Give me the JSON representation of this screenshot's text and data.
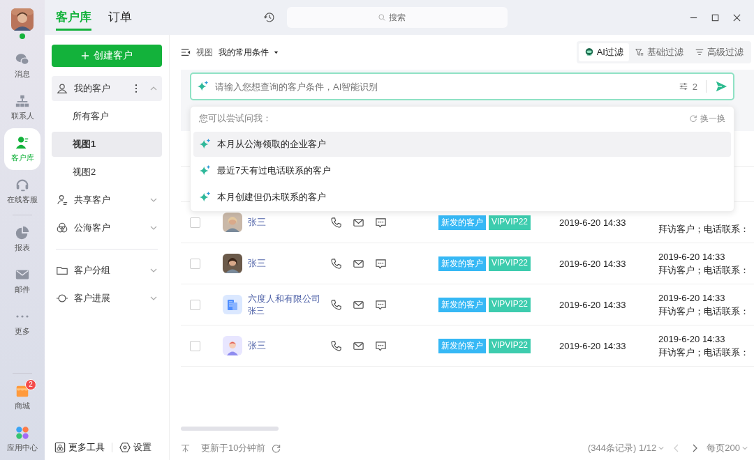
{
  "rail": {
    "items": [
      {
        "label": "消息",
        "selected": false
      },
      {
        "label": "联系人",
        "selected": false
      },
      {
        "label": "客户库",
        "selected": true
      },
      {
        "label": "在线客服",
        "selected": false
      },
      {
        "label": "报表",
        "selected": false
      },
      {
        "label": "邮件",
        "selected": false
      },
      {
        "label": "更多",
        "selected": false
      }
    ],
    "bottom": [
      {
        "label": "商城",
        "badge": "2"
      },
      {
        "label": "应用中心"
      }
    ]
  },
  "tabs": [
    {
      "label": "客户库",
      "selected": true
    },
    {
      "label": "订单",
      "selected": false
    }
  ],
  "search": {
    "placeholder": "搜索"
  },
  "nav": {
    "create_button": "创建客户",
    "sections": [
      [
        {
          "label": "我的客户",
          "expanded": true,
          "children": [
            {
              "label": "所有客户",
              "selected": false
            },
            {
              "label": "视图1",
              "selected": true
            },
            {
              "label": "视图2",
              "selected": false
            }
          ]
        },
        {
          "label": "共享客户",
          "expanded": false
        },
        {
          "label": "公海客户",
          "expanded": false
        }
      ],
      [
        {
          "label": "客户分组",
          "expanded": false
        },
        {
          "label": "客户进展",
          "expanded": false
        }
      ]
    ],
    "footer": [
      {
        "label": "更多工具"
      },
      {
        "label": "设置"
      }
    ]
  },
  "toolbar": {
    "view_label": "视图",
    "view_value": "我的常用条件",
    "filters": [
      {
        "label": "AI过滤",
        "selected": true
      },
      {
        "label": "基础过滤",
        "selected": false
      },
      {
        "label": "高级过滤",
        "selected": false
      }
    ]
  },
  "ai_input": {
    "placeholder": "请输入您想查询的客户条件，AI智能识别",
    "condition_count": "2"
  },
  "suggestions": {
    "title": "您可以尝试问我：",
    "refresh": "换一换",
    "items": [
      {
        "text": "本月从公海领取的企业客户",
        "selected": true
      },
      {
        "text": "最近7天有过电话联系的客户",
        "selected": false
      },
      {
        "text": "本月创建但仍未联系的客户",
        "selected": false
      }
    ]
  },
  "rows": [
    {
      "checked": false,
      "kind": "person",
      "name": "张三",
      "tags": [
        {
          "label": "新发的客户",
          "color": "#36b8f5"
        },
        {
          "label": "VIPVIP22",
          "color": "#3dccae"
        }
      ],
      "date": "2019-6-20 14:33",
      "last_note": "拜访客户；电话联系："
    },
    {
      "checked": false,
      "kind": "person",
      "name": "张三",
      "tags": [
        {
          "label": "新发的客户",
          "color": "#36b8f5"
        },
        {
          "label": "VIPVIP22",
          "color": "#3dccae"
        }
      ],
      "date": "2019-6-20 14:33",
      "last_date": "2019-6-20 14:33",
      "last_note": "拜访客户；电话联系："
    },
    {
      "checked": false,
      "kind": "company",
      "name": "六度人和有限公司",
      "sub": "张三",
      "tags": [
        {
          "label": "新发的客户",
          "color": "#36b8f5"
        },
        {
          "label": "VIPVIP22",
          "color": "#3dccae"
        }
      ],
      "date": "2019-6-20 14:33",
      "last_date": "2019-6-20 14:33",
      "last_note": "拜访客户；电话联系："
    },
    {
      "checked": false,
      "kind": "cartoon",
      "name": "张三",
      "tags": [
        {
          "label": "新发的客户",
          "color": "#36b8f5"
        },
        {
          "label": "VIPVIP22",
          "color": "#3dccae"
        }
      ],
      "date": "2019-6-20 14:33",
      "last_date": "2019-6-20 14:33",
      "last_note": "拜访客户；电话联系："
    }
  ],
  "footer": {
    "updated": "更新于10分钟前",
    "records": "(344条记录) 1/12",
    "per_page": "每页200"
  }
}
